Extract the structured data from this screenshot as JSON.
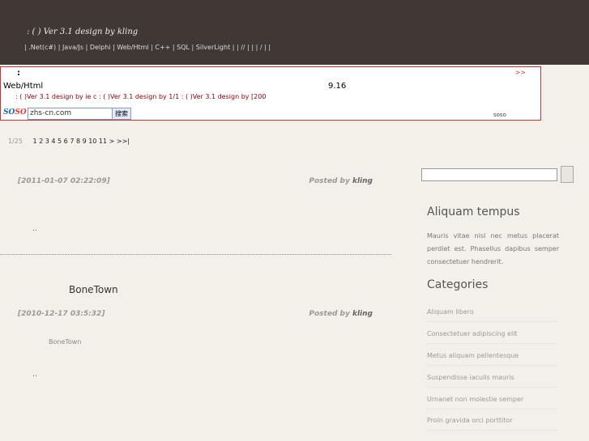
{
  "header": {
    "tagline": ":  (  ) Ver 3.1 design by kling",
    "nav": "| .Net(c#) | Java/Js | Delphi | Web/Html | C++ | SQL | SilverLight |  |  //  |   |   |  /  |   |"
  },
  "notice": {
    "colon": ":",
    "more": ">>",
    "category": "Web/Html",
    "version": "9.16",
    "marquee": ": ( )Ver 3.1 design by ie    c      : ( )Ver 3.1 design by    1/1      : ( )Ver 3.1 design by   [200",
    "soso_logo_a": "SO",
    "soso_logo_b": "SO",
    "search_value": "zhs-cn.com",
    "search_button": "搜索",
    "soso_right": "soso"
  },
  "pager": {
    "count": "1/25",
    "pages": "1 2 3 4 5 6 7 8 9 10 11 > >>|"
  },
  "posts": [
    {
      "date": "[2011-01-07 02:22:09]",
      "posted_by": "Posted by",
      "author": "kling",
      "dots": ".."
    },
    {
      "title": "BoneTown",
      "date": "[2010-12-17 03:5:32]",
      "posted_by": "Posted by",
      "author": "kling",
      "excerpt": "BoneTown",
      "dots": ".."
    }
  ],
  "sidebar": {
    "about_title": "Aliquam tempus",
    "about_text": "Mauris vitae nisl nec metus placerat perdiet est. Phasellus dapibus semper consectetuer hendrerit.",
    "categories_title": "Categories",
    "categories": [
      "Aliquam libero",
      "Consectetuer adipiscing elit",
      "Metus aliquam pellentesque",
      "Suspendisse iaculis mauris",
      "Urnanet non molestie semper",
      "Proin gravida orci porttitor"
    ]
  }
}
